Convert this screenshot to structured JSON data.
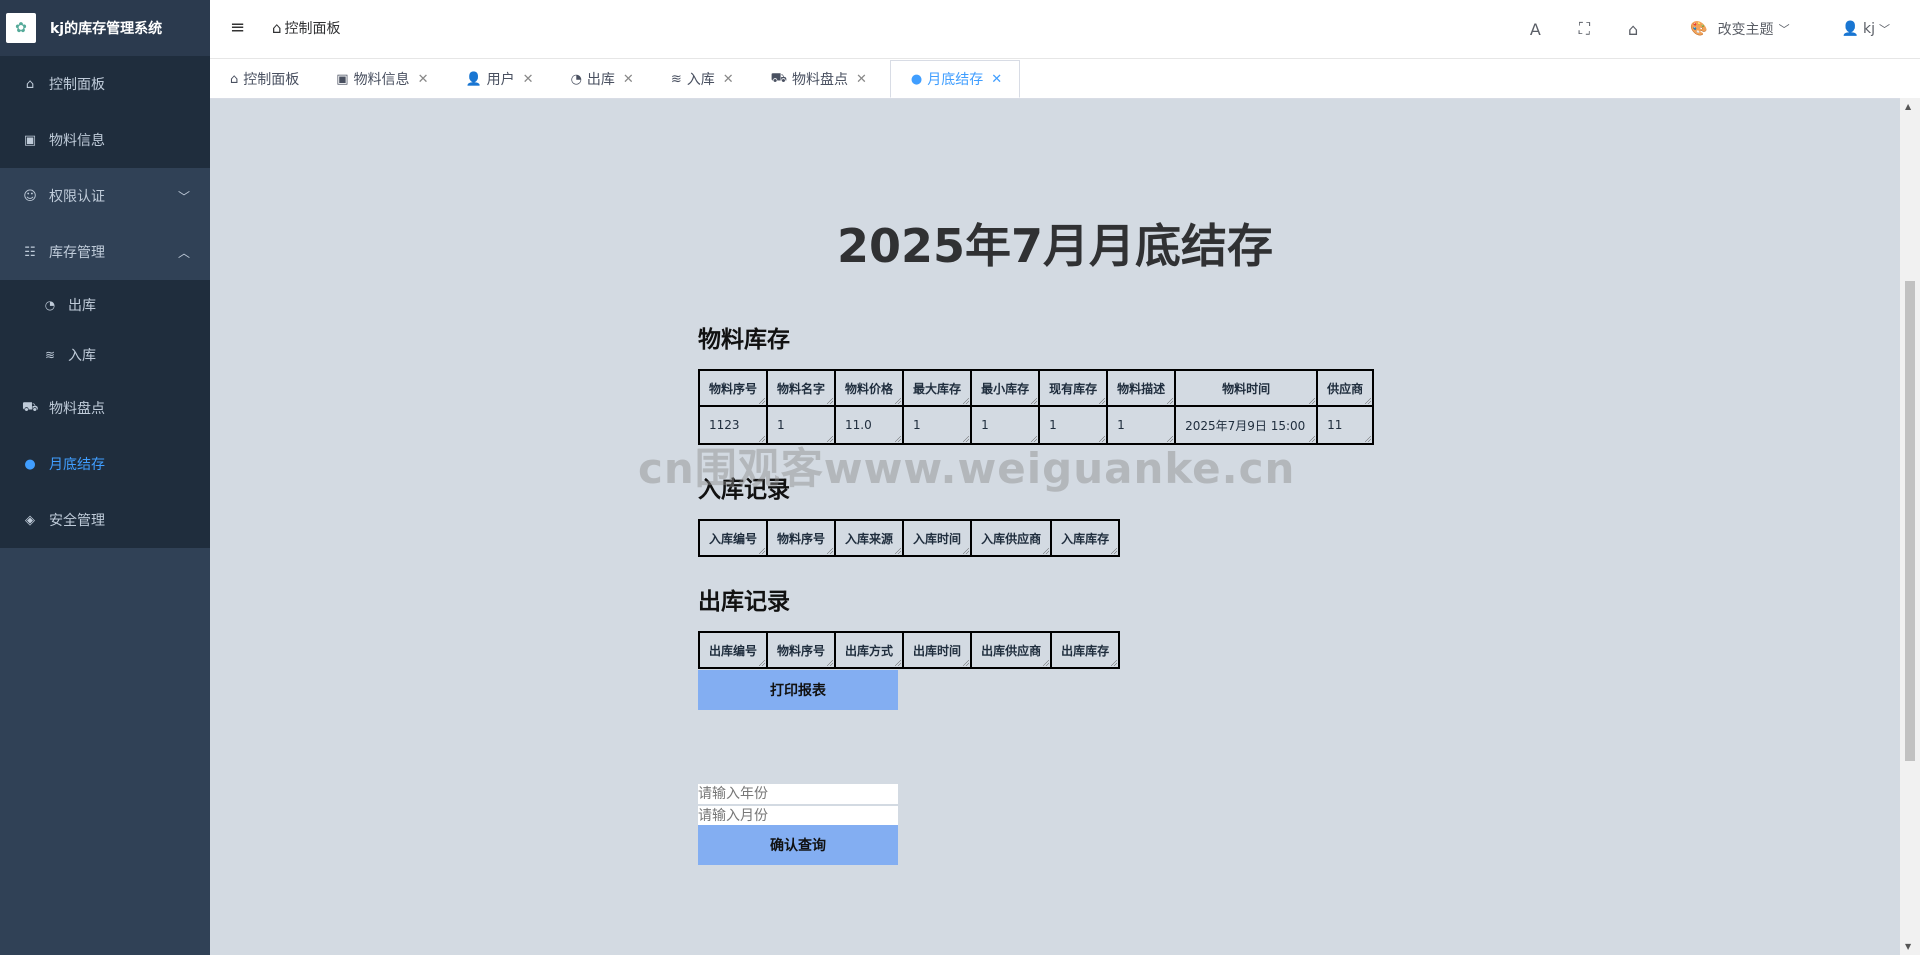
{
  "app": {
    "title": "kj的库存管理系统"
  },
  "sidebar": {
    "items": [
      {
        "label": "控制面板"
      },
      {
        "label": "物料信息"
      },
      {
        "label": "权限认证"
      },
      {
        "label": "库存管理"
      },
      {
        "label": "出库"
      },
      {
        "label": "入库"
      },
      {
        "label": "物料盘点"
      },
      {
        "label": "月底结存"
      },
      {
        "label": "安全管理"
      }
    ]
  },
  "navbar": {
    "breadcrumb": "控制面板",
    "theme_label": "改变主题",
    "user": "kj"
  },
  "tags": [
    {
      "label": "控制面板"
    },
    {
      "label": "物料信息"
    },
    {
      "label": "用户"
    },
    {
      "label": "出库"
    },
    {
      "label": "入库"
    },
    {
      "label": "物料盘点"
    },
    {
      "label": "月底结存"
    }
  ],
  "report": {
    "title": "2025年7月月底结存",
    "inventory": {
      "title": "物料库存",
      "headers": [
        "物料序号",
        "物料名字",
        "物料价格",
        "最大库存",
        "最小库存",
        "现有库存",
        "物料描述",
        "物料时间",
        "供应商"
      ],
      "rows": [
        [
          "1123",
          "1",
          "11.0",
          "1",
          "1",
          "1",
          "1",
          "2025年7月9日 15:00",
          "11"
        ]
      ]
    },
    "inbound": {
      "title": "入库记录",
      "headers": [
        "入库编号",
        "物料序号",
        "入库来源",
        "入库时间",
        "入库供应商",
        "入库库存"
      ]
    },
    "outbound": {
      "title": "出库记录",
      "headers": [
        "出库编号",
        "物料序号",
        "出库方式",
        "出库时间",
        "出库供应商",
        "出库库存"
      ]
    },
    "print_button": "打印报表",
    "year_placeholder": "请输入年份",
    "month_placeholder": "请输入月份",
    "query_button": "确认查询"
  },
  "watermark": "cn围观客www.weiguanke.cn",
  "colors": {
    "sidebar": "#304156",
    "active": "#409eff",
    "content_bg": "#d3dae2",
    "button": "#83aef2"
  }
}
